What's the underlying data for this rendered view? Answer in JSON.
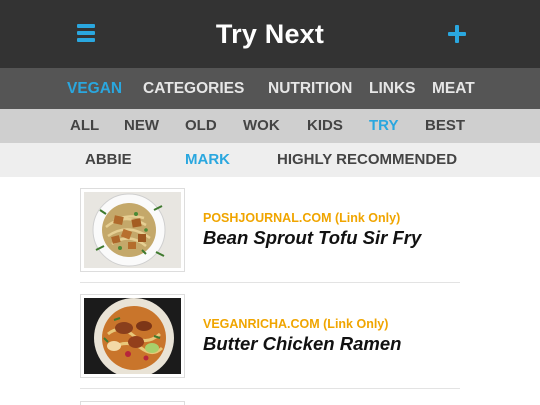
{
  "header": {
    "title": "Try Next",
    "menu_icon": "hamburger-menu-icon",
    "add_icon": "plus-icon",
    "accent_color": "#2aa7df",
    "bar_color": "#333333"
  },
  "primary_tabs": [
    {
      "label": "VEGAN",
      "active": true
    },
    {
      "label": "CATEGORIES",
      "active": false
    },
    {
      "label": "NUTRITION",
      "active": false
    },
    {
      "label": "LINKS",
      "active": false
    },
    {
      "label": "MEAT",
      "active": false
    }
  ],
  "filter_tabs": [
    {
      "label": "ALL",
      "active": false
    },
    {
      "label": "NEW",
      "active": false
    },
    {
      "label": "OLD",
      "active": false
    },
    {
      "label": "WOK",
      "active": false
    },
    {
      "label": "KIDS",
      "active": false
    },
    {
      "label": "TRY",
      "active": true
    },
    {
      "label": "BEST",
      "active": false
    }
  ],
  "user_tabs": [
    {
      "label": "ABBIE",
      "active": false
    },
    {
      "label": "MARK",
      "active": true
    },
    {
      "label": "HIGHLY RECOMMENDED",
      "active": false
    }
  ],
  "recipes": [
    {
      "source": "POSHJOURNAL.COM (Link Only)",
      "title": "Bean Sprout Tofu Sir Fry",
      "thumb": "tofu-stir-fry-photo"
    },
    {
      "source": "VEGANRICHA.COM (Link Only)",
      "title": "Butter Chicken Ramen",
      "thumb": "ramen-bowl-photo"
    }
  ],
  "source_color": "#f0a500"
}
